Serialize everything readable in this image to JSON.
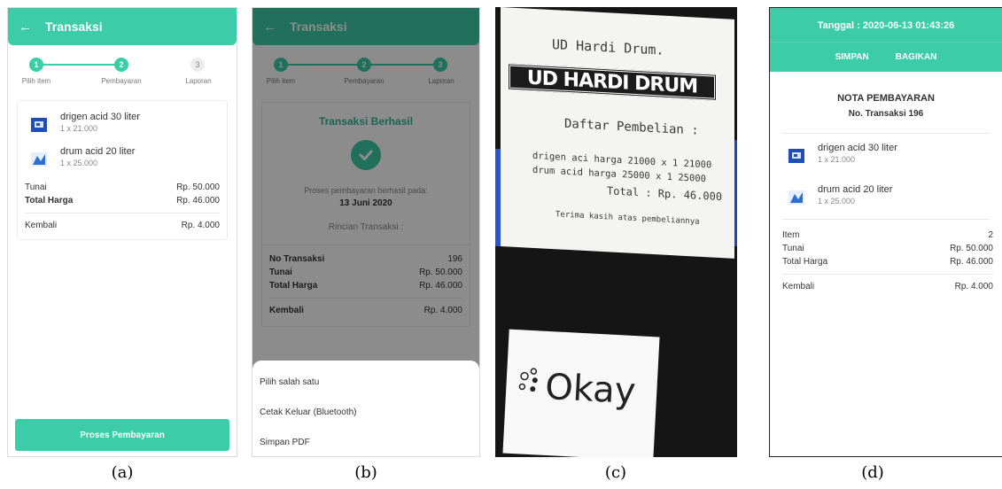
{
  "appbar": {
    "back_glyph": "←",
    "title": "Transaksi"
  },
  "stepper": {
    "steps": [
      {
        "num": "1",
        "label": "Pilih item"
      },
      {
        "num": "2",
        "label": "Pembayaran"
      },
      {
        "num": "3",
        "label": "Laporan"
      }
    ]
  },
  "items": [
    {
      "name": "drigen acid 30 liter",
      "qty": "1 x 21.000",
      "icon": "drigen-product-icon"
    },
    {
      "name": "drum acid 20 liter",
      "qty": "1 x 25.000",
      "icon": "drum-product-icon"
    }
  ],
  "panel_a": {
    "tunai_label": "Tunai",
    "tunai_value": "Rp. 50.000",
    "total_label": "Total Harga",
    "total_value": "Rp. 46.000",
    "kembali_label": "Kembali",
    "kembali_value": "Rp. 4.000",
    "button": "Proses Pembayaran"
  },
  "panel_b": {
    "success_title": "Transaksi Berhasil",
    "process_text": "Proses pembayaran berhasil pada:",
    "date": "13 Juni 2020",
    "rincian": "Rincian Transaksi :",
    "no_label": "No Transaksi",
    "no_value": "196",
    "tunai_label": "Tunai",
    "tunai_value": "Rp. 50.000",
    "total_label": "Total Harga",
    "total_value": "Rp. 46.000",
    "kembali_label": "Kembali",
    "kembali_value": "Rp. 4.000",
    "sheet": {
      "title": "Pilih salah satu",
      "option_print": "Cetak Keluar (Bluetooth)",
      "option_pdf": "Simpan PDF"
    }
  },
  "panel_c": {
    "line1": "UD Hardi Drum.",
    "logo": "UD HARDI DRUM",
    "line2": "Daftar Pembelian :",
    "line3": "drigen aci harga 21000 x 1 21000",
    "line4": "drum acid  harga 25000 x 1 25000",
    "line5": "Total :  Rp. 46.000",
    "line6": "Terima kasih atas pembeliannya",
    "okay": "Okay"
  },
  "panel_d": {
    "date": "Tanggal : 2020-06-13 01:43:26",
    "save": "SIMPAN",
    "share": "BAGIKAN",
    "title": "NOTA PEMBAYARAN",
    "subtitle": "No. Transaksi 196",
    "item_label": "Item",
    "item_value": "2",
    "tunai_label": "Tunai",
    "tunai_value": "Rp. 50.000",
    "total_label": "Total Harga",
    "total_value": "Rp. 46.000",
    "kembali_label": "Kembali",
    "kembali_value": "Rp. 4.000"
  },
  "captions": {
    "a": "(a)",
    "b": "(b)",
    "c": "(c)",
    "d": "(d)"
  },
  "colors": {
    "accent": "#3dcca8",
    "accent_dark": "#2fb894"
  }
}
